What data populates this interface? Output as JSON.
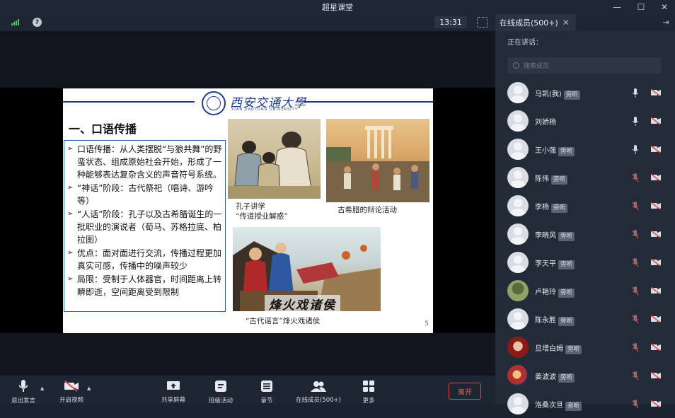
{
  "window": {
    "title": "超星课堂"
  },
  "topbar": {
    "timer": "13:31"
  },
  "slide": {
    "university_cn": "西安交通大學",
    "university_en": "XIAN JIAOTONG UNIVERSITY",
    "heading": "一、口语传播",
    "bullets": [
      "口语传播：从人类摆脱“与狼共舞”的野蛮状态、组成原始社会开始，形成了一种能够表达复杂含义的声音符号系统。",
      "“神话”阶段：古代祭祀（唱诗、游吟等）",
      "“人话”阶段：孔子以及古希腊诞生的一批职业的演说者（荀马、苏格拉底、柏拉图）",
      "优点：面对面进行交流，传播过程更加真实可感，传播中的噪声较少",
      "局限：受制于人体器官，时间距离上转瞬即逝，空间距离受到限制"
    ],
    "caption1": "孔子讲学\n“传道授业解惑”",
    "caption2": "古希腊的辩论活动",
    "caption3": "“古代谣言”烽火戏诸侯",
    "calligraphy": "烽火戏诸侯",
    "page_number": "5"
  },
  "toolbar": {
    "mic_label": "退出发言",
    "video_label": "开启视频",
    "share_label": "共享屏幕",
    "activity_label": "班级活动",
    "chapter_label": "章节",
    "members_label": "在线成员(500+)",
    "more_label": "更多",
    "leave_label": "离开"
  },
  "sidebar": {
    "tab_label": "在线成员(500+)",
    "speaking_label": "正在讲话：",
    "search_placeholder": "搜索成员",
    "members": [
      {
        "name": "马凯(我)",
        "badge": "旁听",
        "mic": "on"
      },
      {
        "name": "刘娇杨",
        "badge": "",
        "mic": "on"
      },
      {
        "name": "王小强",
        "badge": "旁听",
        "mic": "on"
      },
      {
        "name": "陈伟",
        "badge": "旁听",
        "mic": "off"
      },
      {
        "name": "李杨",
        "badge": "旁听",
        "mic": "off"
      },
      {
        "name": "李晓风",
        "badge": "旁听",
        "mic": "off"
      },
      {
        "name": "李天平",
        "badge": "旁听",
        "mic": "off"
      },
      {
        "name": "卢艳玲",
        "badge": "旁听",
        "mic": "off"
      },
      {
        "name": "陈永胜",
        "badge": "旁听",
        "mic": "off"
      },
      {
        "name": "旦增白姆",
        "badge": "旁听",
        "mic": "off"
      },
      {
        "name": "姜波波",
        "badge": "旁听",
        "mic": "off"
      },
      {
        "name": "洛桑次旦",
        "badge": "旁听",
        "mic": "off"
      }
    ]
  },
  "colors": {
    "accent_red": "#e04b4b",
    "signal_green": "#3bcc59"
  }
}
